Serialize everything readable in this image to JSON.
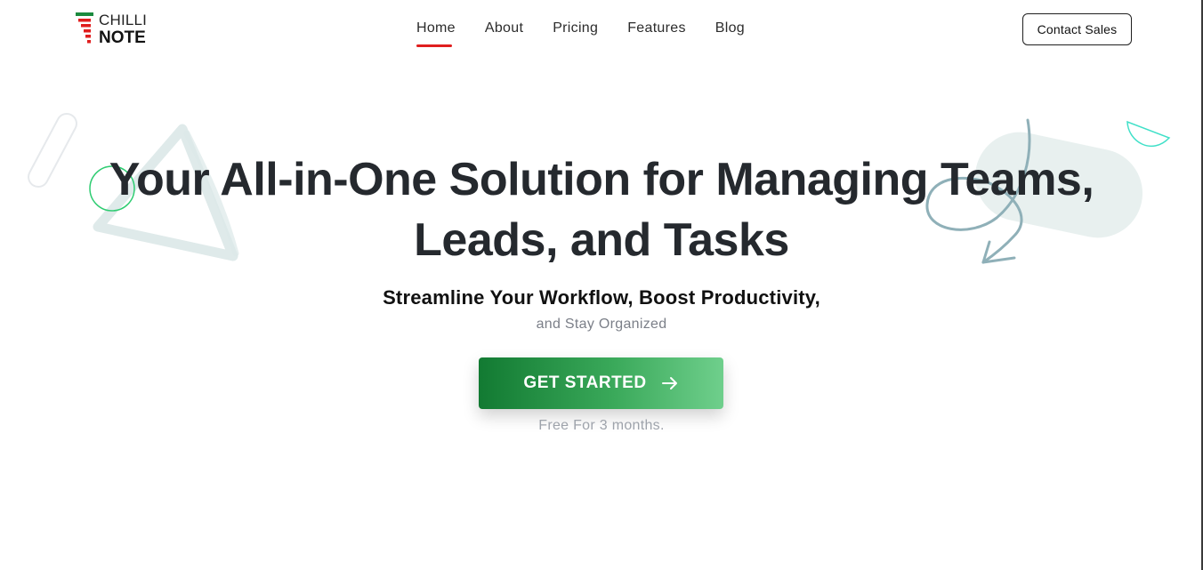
{
  "brand": {
    "logo_top": "CHILLI",
    "logo_bottom": "NOTE",
    "accent_red": "#e01e1e",
    "accent_green": "#1b8a3e"
  },
  "nav": {
    "items": [
      {
        "label": "Home",
        "active": true
      },
      {
        "label": "About",
        "active": false
      },
      {
        "label": "Pricing",
        "active": false
      },
      {
        "label": "Features",
        "active": false
      },
      {
        "label": "Blog",
        "active": false
      }
    ]
  },
  "header": {
    "contact_label": "Contact Sales"
  },
  "hero": {
    "title_line1": "Your All-in-One Solution for Managing Teams,",
    "title_line2": "Leads, and Tasks",
    "subtitle_line1": "Streamline Your Workflow, Boost Productivity,",
    "subtitle_line2": "and Stay Organized",
    "cta_label": "GET STARTED",
    "cta_icon": "arrow-right-icon",
    "cta_note": "Free For 3 months."
  }
}
